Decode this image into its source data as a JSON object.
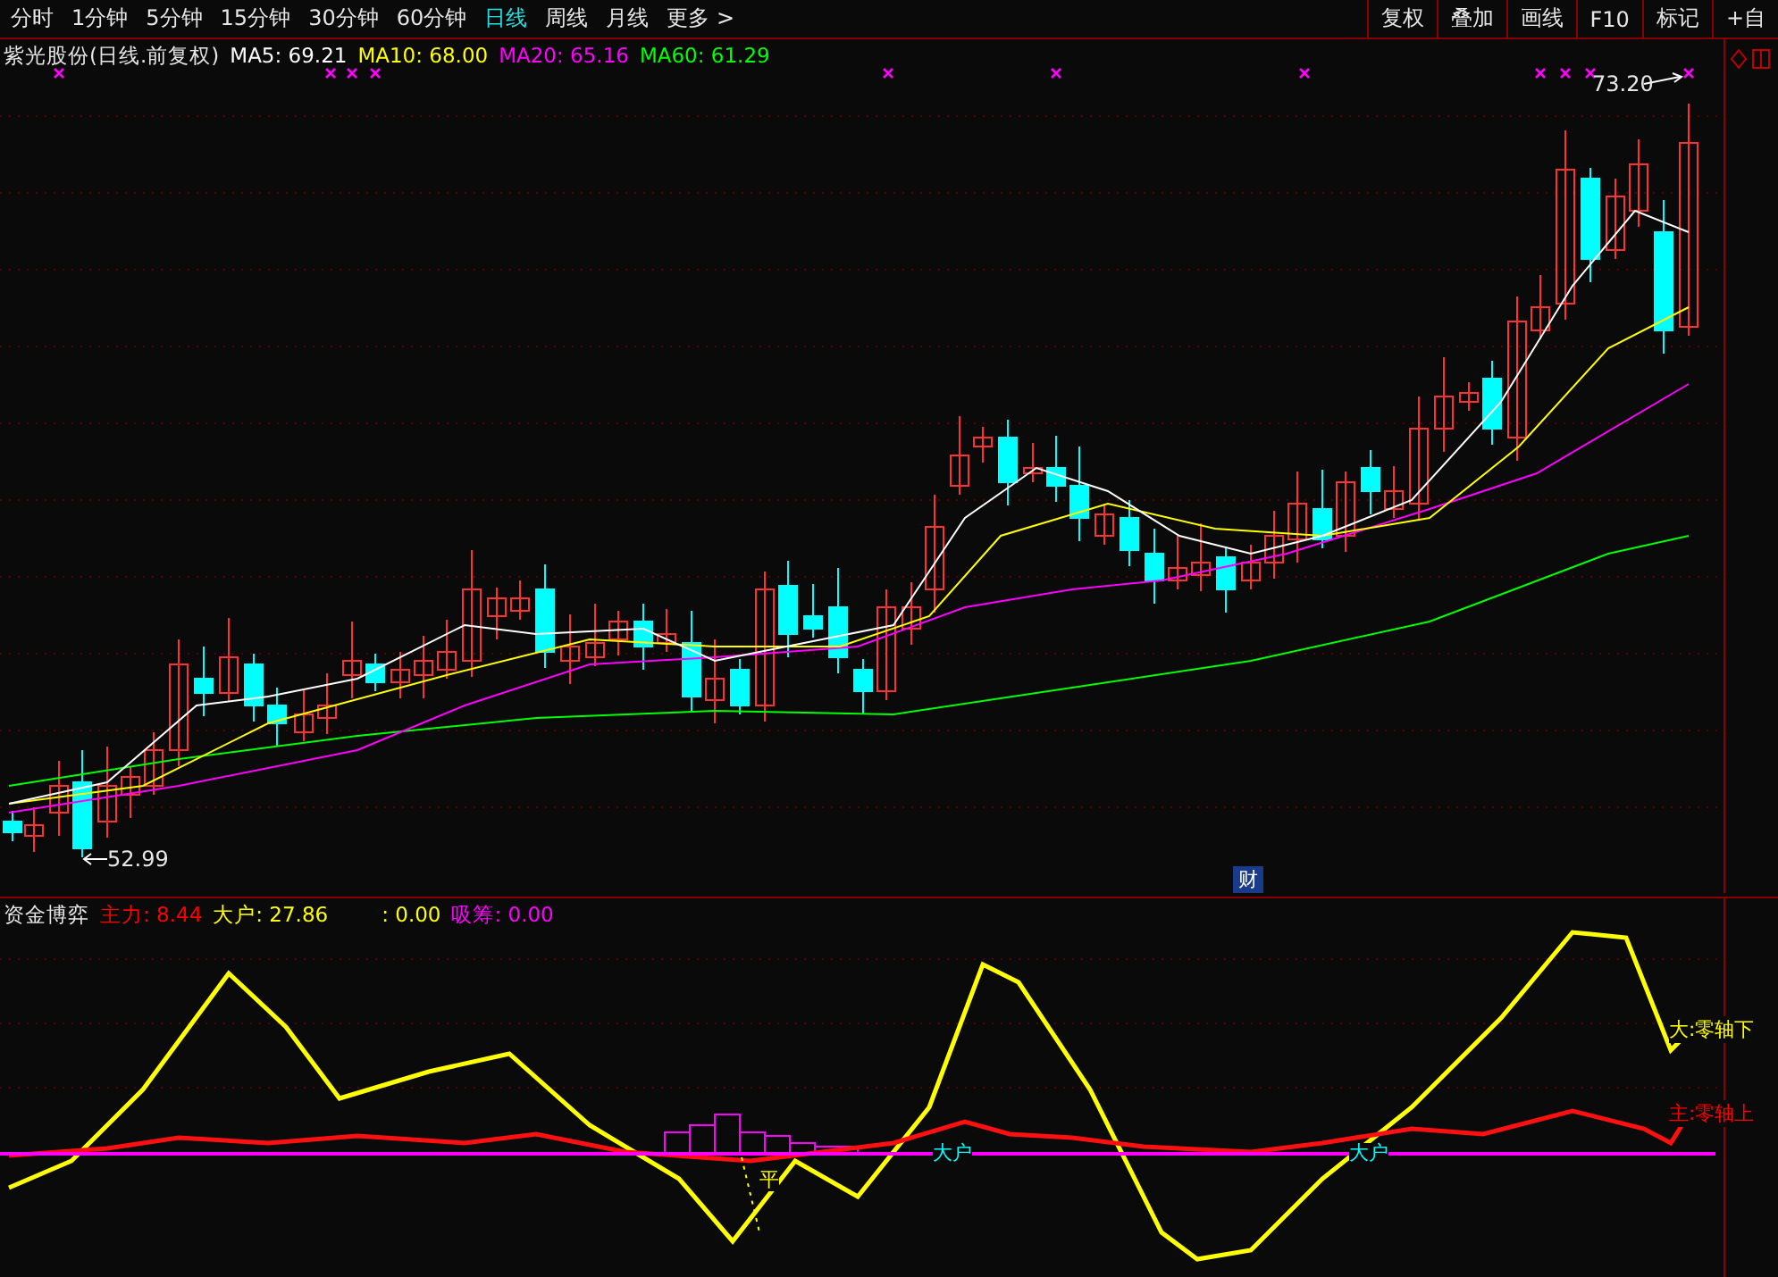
{
  "toolbar": {
    "periods": [
      {
        "label": "分时",
        "selected": false
      },
      {
        "label": "1分钟",
        "selected": false
      },
      {
        "label": "5分钟",
        "selected": false
      },
      {
        "label": "15分钟",
        "selected": false
      },
      {
        "label": "30分钟",
        "selected": false
      },
      {
        "label": "60分钟",
        "selected": false
      },
      {
        "label": "日线",
        "selected": true
      },
      {
        "label": "周线",
        "selected": false
      },
      {
        "label": "月线",
        "selected": false
      },
      {
        "label": "更多 >",
        "selected": false
      }
    ],
    "buttons": [
      "复权",
      "叠加",
      "画线",
      "F10",
      "标记",
      "+自"
    ]
  },
  "price_panel": {
    "title": "紫光股份(日线.前复权)",
    "indicators": [
      {
        "label": "MA5: 69.21",
        "color": "#ffffff"
      },
      {
        "label": "MA10: 68.00",
        "color": "#ffff00"
      },
      {
        "label": "MA20: 65.16",
        "color": "#ff00ff"
      },
      {
        "label": "MA60: 61.29",
        "color": "#00ff00"
      }
    ],
    "high_label": "73.20",
    "low_label": "52.99",
    "event_marker": "财"
  },
  "indicator_panel": {
    "title": "资金博弈",
    "readings": [
      {
        "label": "主力: 8.44",
        "color": "#ff0000"
      },
      {
        "label": "大户: 27.86",
        "color": "#ffff00"
      },
      {
        "label": ": 0.00",
        "color": "#ffff00"
      },
      {
        "label": "吸筹: 0.00",
        "color": "#ff00ff"
      }
    ],
    "line_labels": [
      {
        "text": "大:零轴下",
        "color": "#ffff00"
      },
      {
        "text": "主:零轴上",
        "color": "#ff0000"
      }
    ],
    "marks": [
      {
        "text": "平",
        "color": "#ffff00"
      },
      {
        "text": "大户",
        "color": "#00ffff"
      },
      {
        "text": "大户",
        "color": "#00ffff"
      }
    ]
  }
}
